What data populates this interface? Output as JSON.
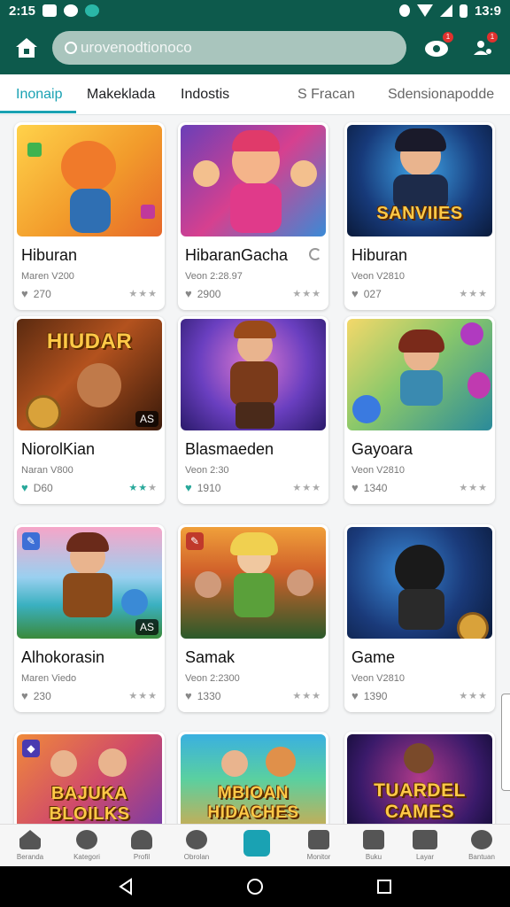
{
  "status_bar": {
    "time": "2:15",
    "clock": "13:9"
  },
  "app_bar": {
    "search_placeholder": "urovenodtionoco",
    "notif_badge": "1",
    "profile_badge": "1"
  },
  "tabs": [
    {
      "label": "Inonaip"
    },
    {
      "label": "Makeklada"
    },
    {
      "label": "Indostis"
    },
    {
      "label": "S Fracan"
    },
    {
      "label": "Sdensionapodde"
    }
  ],
  "cards": [
    {
      "title": "Hiburan",
      "sub": "Maren V200",
      "likes": "270",
      "art_text": "",
      "corner": ""
    },
    {
      "title": "HibaranGacha",
      "sub": "Veon 2:28.97",
      "likes": "2900",
      "art_text": "",
      "corner": ""
    },
    {
      "title": "Hiburan",
      "sub": "Veon V2810",
      "likes": "027",
      "art_text": "SANVIIES",
      "corner": ""
    },
    {
      "title": "NiorolKian",
      "sub": "Naran V800",
      "likes": "D60",
      "art_text": "HIUDAR",
      "corner": "AS"
    },
    {
      "title": "Blasmaeden",
      "sub": "Veon 2:30",
      "likes": "1910",
      "art_text": "",
      "corner": ""
    },
    {
      "title": "Gayoara",
      "sub": "Veon V2810",
      "likes": "1340",
      "art_text": "",
      "corner": ""
    },
    {
      "title": "Alhokorasin",
      "sub": "Maren Viedo",
      "likes": "230",
      "art_text": "",
      "corner": "AS"
    },
    {
      "title": "Samak",
      "sub": "Veon 2:2300",
      "likes": "1330",
      "art_text": "",
      "corner": ""
    },
    {
      "title": "Game",
      "sub": "Veon V2810",
      "likes": "1390",
      "art_text": "",
      "corner": ""
    },
    {
      "title": "",
      "sub": "",
      "likes": "",
      "art_text": "BAJUKA BLOILKS",
      "corner": ""
    },
    {
      "title": "",
      "sub": "",
      "likes": "",
      "art_text": "MBIOAN HIDACHES",
      "corner": ""
    },
    {
      "title": "",
      "sub": "",
      "likes": "",
      "art_text": "TUARDEL CAMES",
      "corner": ""
    }
  ],
  "bottom_nav": [
    {
      "label": "Beranda",
      "icon": "home-icon"
    },
    {
      "label": "Kategori",
      "icon": "search-icon"
    },
    {
      "label": "Profil",
      "icon": "user-icon"
    },
    {
      "label": "Obrolan",
      "icon": "chat-icon"
    },
    {
      "label": "",
      "icon": "apps-icon"
    },
    {
      "label": "Monitor",
      "icon": "monitor-icon"
    },
    {
      "label": "Buku",
      "icon": "book-icon"
    },
    {
      "label": "Layar",
      "icon": "screen-icon"
    },
    {
      "label": "Bantuan",
      "icon": "help-icon"
    }
  ],
  "colors": {
    "primary": "#0d5a4c",
    "accent": "#1aa2b3",
    "badge": "#e0312e"
  }
}
